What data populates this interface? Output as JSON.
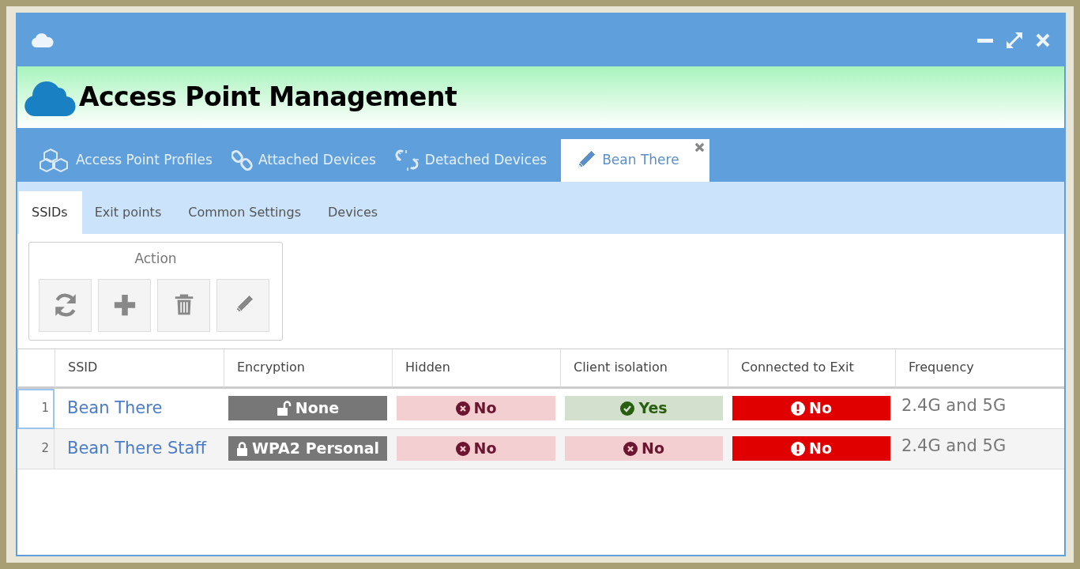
{
  "window": {
    "title": "Access Point Management"
  },
  "tabs": [
    {
      "label": "Access Point Profiles",
      "selected": false,
      "closable": false
    },
    {
      "label": "Attached Devices",
      "selected": false,
      "closable": false
    },
    {
      "label": "Detached Devices",
      "selected": false,
      "closable": false
    },
    {
      "label": "Bean There",
      "selected": true,
      "closable": true
    }
  ],
  "subtabs": [
    {
      "label": "SSIDs",
      "selected": true
    },
    {
      "label": "Exit points",
      "selected": false
    },
    {
      "label": "Common Settings",
      "selected": false
    },
    {
      "label": "Devices",
      "selected": false
    }
  ],
  "action_group": {
    "title": "Action"
  },
  "table": {
    "columns": [
      "SSID",
      "Encryption",
      "Hidden",
      "Client isolation",
      "Connected to Exit",
      "Frequency"
    ],
    "rows": [
      {
        "number": "1",
        "selected": true,
        "ssid": "Bean There",
        "badges": [
          {
            "text": "None",
            "kind": "unlocked"
          },
          {
            "text": "No",
            "kind": "negative"
          },
          {
            "text": "Yes",
            "kind": "positive"
          },
          {
            "text": "No",
            "kind": "alert"
          }
        ],
        "frequency": "2.4G and 5G"
      },
      {
        "number": "2",
        "selected": false,
        "ssid": "Bean There Staff",
        "badges": [
          {
            "text": "WPA2 Personal",
            "kind": "locked"
          },
          {
            "text": "No",
            "kind": "negative"
          },
          {
            "text": "No",
            "kind": "negative"
          },
          {
            "text": "No",
            "kind": "alert"
          }
        ],
        "frequency": "2.4G and 5G"
      }
    ]
  }
}
